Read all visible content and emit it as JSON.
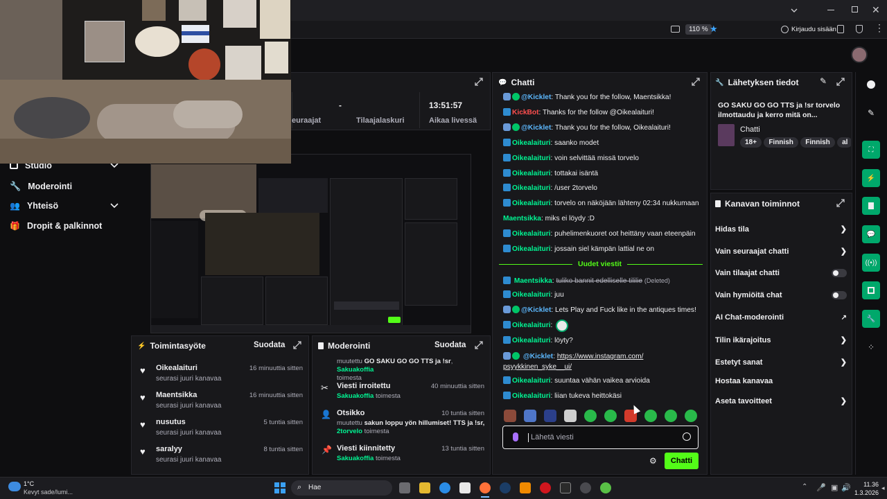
{
  "browser": {
    "zoom": "110 %",
    "login_label": "Kirjaudu sisään"
  },
  "stats": {
    "items": [
      {
        "value": "",
        "label": "euraajat"
      },
      {
        "value": "-",
        "label": "Tilaajalaskuri"
      },
      {
        "value": "13:51:57",
        "label": "Aikaa livessä"
      }
    ]
  },
  "left_nav": {
    "items": [
      {
        "label": "Studio",
        "icon": "studio-icon"
      },
      {
        "label": "Moderointi",
        "icon": "wrench-icon"
      },
      {
        "label": "Yhteisö",
        "icon": "community-icon"
      },
      {
        "label": "Dropit & palkinnot",
        "icon": "gift-icon"
      }
    ]
  },
  "activity": {
    "title": "Toimintasyöte",
    "filter": "Suodata",
    "items": [
      {
        "name": "Oikealaituri",
        "sub": "seurasi juuri kanavaa",
        "time": "16 minuuttia sitten"
      },
      {
        "name": "Maentsikka",
        "sub": "seurasi juuri kanavaa",
        "time": "16 minuuttia sitten"
      },
      {
        "name": "nusutus",
        "sub": "seurasi juuri kanavaa",
        "time": "5 tuntia sitten"
      },
      {
        "name": "saralyy",
        "sub": "seurasi juuri kanavaa",
        "time": "8 tuntia sitten"
      }
    ]
  },
  "moderation": {
    "title": "Moderointi",
    "filter": "Suodata",
    "first_prefix": "muutettu",
    "first_bold": "GO SAKU GO GO TTS ja !sr",
    "first_user": "Sakuakoffia",
    "first_suffix": "toimesta",
    "items": [
      {
        "title": "Viesti irroitettu",
        "user": "Sakuakoffia",
        "suffix": "toimesta",
        "time": "40 minuuttia sitten"
      },
      {
        "title": "Otsikko",
        "prefix": "muutettu",
        "text": "sakun loppu yön hillumiset! TTS ja !sr,",
        "user": "2torvelo",
        "suffix": "toimesta",
        "time": "10 tuntia sitten"
      },
      {
        "title": "Viesti kiinnitetty",
        "user": "Sakuakoffia",
        "suffix": "toimesta",
        "time": "13 tuntia sitten"
      }
    ]
  },
  "chat": {
    "title": "Chatti",
    "messages": [
      {
        "user": "@Kicklet",
        "text": ": Thank you for the follow, Maentsikka!",
        "color": "#5cb8ff"
      },
      {
        "user": "KickBot",
        "text": ": Thanks for the follow @Oikealaituri!",
        "color": "#ff4f4f"
      },
      {
        "user": "@Kicklet",
        "text": ": Thank you for the follow, Oikealaituri!",
        "color": "#5cb8ff"
      },
      {
        "user": "Oikealaituri",
        "text": ": saanko modet",
        "color": "#00f593"
      },
      {
        "user": "Oikealaituri",
        "text": ": voin selvittää missä torvelo",
        "color": "#00f593"
      },
      {
        "user": "Oikealaituri",
        "text": ": tottakai isäntä",
        "color": "#00f593"
      },
      {
        "user": "Oikealaituri",
        "text": ": /user 2torvelo",
        "color": "#00f593"
      },
      {
        "user": "Oikealaituri",
        "text": ": torvelo on näköjään lähteny 02:34 nukkumaan",
        "color": "#00f593"
      },
      {
        "user": "Maentsikka",
        "text": ": miks ei löydy :D",
        "color": "#00f593"
      },
      {
        "user": "Oikealaituri",
        "text": ": puhelimenkuoret oot heittäny vaan eteenpäin",
        "color": "#00f593"
      },
      {
        "user": "Oikealaituri",
        "text": ": jossain siel kämpän lattial ne on",
        "color": "#00f593"
      }
    ],
    "new_messages_label": "Uudet viestit",
    "deleted_user": "Maentsikka",
    "deleted_text": "tuliko bannit edelliselle tililie",
    "deleted_tag": "(Deleted)",
    "messages2": [
      {
        "user": "Oikealaituri",
        "text": ": juu",
        "color": "#00f593"
      },
      {
        "user": "@Kicklet",
        "text": ": Lets Play and Fuck like in the antiques times!",
        "color": "#5cb8ff"
      },
      {
        "user": "Oikealaituri",
        "text": ":",
        "color": "#00f593"
      },
      {
        "user": "Oikealaituri",
        "text": ": löyty?",
        "color": "#00f593"
      }
    ],
    "link_user": "@Kicklet",
    "link_line1": "https://www.instagram.com/",
    "link_line2": "psyykkinen_syke__ui/",
    "messages3": [
      {
        "user": "Oikealaituri",
        "text": ": suuntaa vähän vaikea arvioida",
        "color": "#00f593"
      },
      {
        "user": "Oikealaituri",
        "text": ": liian tukeva heittokäsi",
        "color": "#00f593"
      }
    ],
    "input_placeholder": "Lähetä viesti",
    "send_label": "Chatti"
  },
  "stream_info": {
    "title": "Lähetyksen tiedot",
    "stream_title": "GO SAKU GO GO TTS ja !sr torvelo ilmottaudu ja kerro mitä on...",
    "category": "Chatti",
    "tags": [
      "18+",
      "Finnish",
      "Finnish",
      "al"
    ]
  },
  "channel_actions": {
    "title": "Kanavan toiminnot",
    "items": [
      {
        "label": "Hidas tila",
        "control": "chevron"
      },
      {
        "label": "Vain seuraajat chatti",
        "control": "chevron"
      },
      {
        "label": "Vain tilaajat chatti",
        "control": "toggle"
      },
      {
        "label": "Vain hymiöitä chat",
        "control": "toggle"
      },
      {
        "label": "AI Chat-moderointi",
        "control": "external"
      },
      {
        "label": "Tilin ikärajoitus",
        "control": "chevron"
      },
      {
        "label": "Estetyt sanat",
        "control": "chevron"
      },
      {
        "label": "Hostaa kanavaa",
        "control": "none"
      },
      {
        "label": "Aseta tavoitteet",
        "control": "chevron"
      }
    ]
  },
  "taskbar": {
    "weather_temp": "1°C",
    "weather_desc": "Kevyt sade/lumi...",
    "search_label": "Hae",
    "time": "11.36",
    "date": "1.3.2026"
  },
  "colors": {
    "accent": "#53fc18",
    "panel_bg": "#18181b",
    "page_bg": "#0e0e10"
  }
}
